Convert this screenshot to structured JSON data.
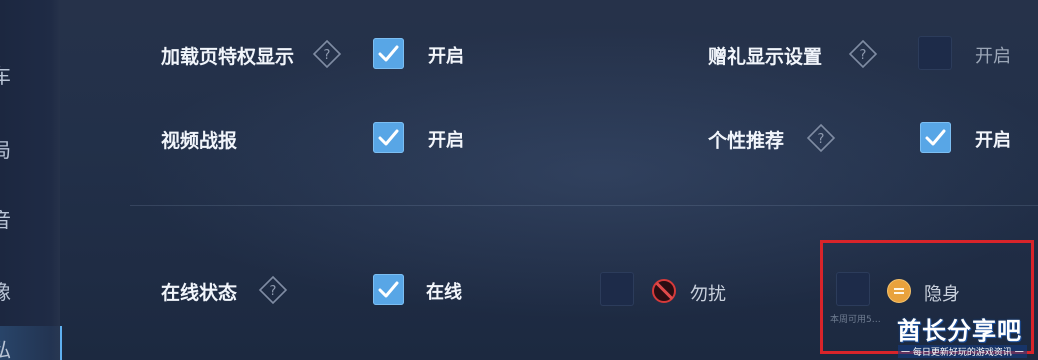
{
  "sidebar": {
    "items": [
      {
        "label": "车"
      },
      {
        "label": "局"
      },
      {
        "label": "音"
      },
      {
        "label": "像"
      },
      {
        "label": "私"
      }
    ]
  },
  "settings": {
    "loading_privilege": {
      "label": "加载页特权显示",
      "option": "开启",
      "checked": true
    },
    "gift_display": {
      "label": "赠礼显示设置",
      "option": "开启",
      "checked": false
    },
    "video_report": {
      "label": "视频战报",
      "option": "开启",
      "checked": true
    },
    "personal_recommend": {
      "label": "个性推荐",
      "option": "开启",
      "checked": true
    }
  },
  "online_status": {
    "label": "在线状态",
    "options": [
      {
        "label": "在线",
        "checked": true,
        "icon": "none"
      },
      {
        "label": "勿扰",
        "checked": false,
        "icon": "busy-icon"
      },
      {
        "label": "隐身",
        "checked": false,
        "icon": "hidden-icon"
      }
    ],
    "footnote": "本周可用5…"
  },
  "watermark": {
    "title": "酋长分享吧",
    "subtitle": "一 每日更新好玩的游戏资讯 一"
  },
  "colors": {
    "background": "#223049",
    "checkbox_on": "#58a6e6",
    "checkbox_off": "#1d2b49",
    "annotation": "#d8242a"
  }
}
